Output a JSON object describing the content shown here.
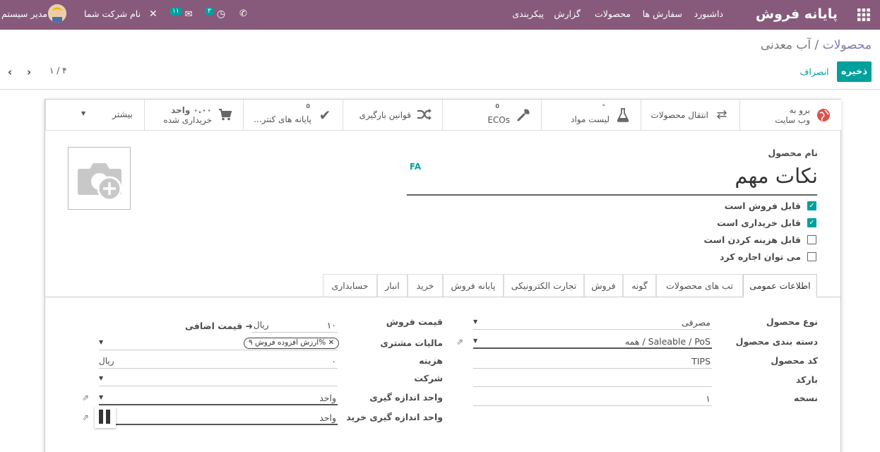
{
  "topbar": {
    "brand": "پایانه فروش",
    "menu": [
      "داشبورد",
      "سفارش ها",
      "محصولات",
      "گزارش",
      "پیکربندی"
    ],
    "user": "مدیر سیستم",
    "company": "نام شرکت شما",
    "messages_count": "۱۱",
    "activities_count": "۳"
  },
  "control": {
    "breadcrumb_parent": "محصولات",
    "breadcrumb_sep": "/",
    "breadcrumb_current": "آب معدنی",
    "save": "ذخیره",
    "discard": "انصراف",
    "pager": "۱ / ۴"
  },
  "smart_buttons": {
    "website_line1": "برو به",
    "website_line2": "وب سایت",
    "transfers": "انتقال محصولات",
    "bom": "لیست مواد",
    "ecos": "ECOs",
    "ecos_count": "0",
    "putaway": "قوانین بارگیری",
    "pos": "پایانه های کنتر...",
    "pos_count": "0",
    "purchased_value": "۰.۰۰ واحد",
    "purchased_label": "خریداری شده",
    "more": "بیشتر"
  },
  "form": {
    "name_label": "نام محصول",
    "lang": "FA",
    "name_value": "نکات مهم",
    "checks": [
      {
        "label": "قابل فروش است",
        "checked": true
      },
      {
        "label": "قابل خریداری است",
        "checked": true
      },
      {
        "label": "قابل هزینه کردن است",
        "checked": false
      },
      {
        "label": "می توان اجاره کرد",
        "checked": false
      }
    ]
  },
  "tabs": [
    "اطلاعات عمومی",
    "تب های محصولات",
    "گونه",
    "فروش",
    "تجارت الکترونیکی",
    "پایانه فروش",
    "خرید",
    "انبار",
    "حسابداری"
  ],
  "general": {
    "type_label": "نوع محصول",
    "type_value": "مصرفی",
    "categ_label": "دسته بندی محصول",
    "categ_value": "همه / Saleable / PoS",
    "code_label": "کد محصول",
    "code_value": "TIPS",
    "barcode_label": "بارکد",
    "barcode_value": "",
    "version_label": "نسخه",
    "version_value": "۱",
    "price_label": "قیمت فروش",
    "price_value": "۱۰",
    "price_currency": "ریال",
    "extra_price": "قیمت اضافی",
    "tax_label": "مالیات مشتری",
    "tax_tag": "ارزش افزوده فروش ۹%",
    "cost_label": "هزینه",
    "cost_value": "۰",
    "cost_currency": "ریال",
    "company_label": "شرکت",
    "company_value": "",
    "uom_label": "واحد اندازه گیری",
    "uom_value": "واحد",
    "uom_po_label": "واحد اندازه گیری خرید",
    "uom_po_value": "واحد"
  },
  "colors": {
    "primary": "#875a7b",
    "accent": "#00a09d",
    "link": "#7c7bad"
  }
}
